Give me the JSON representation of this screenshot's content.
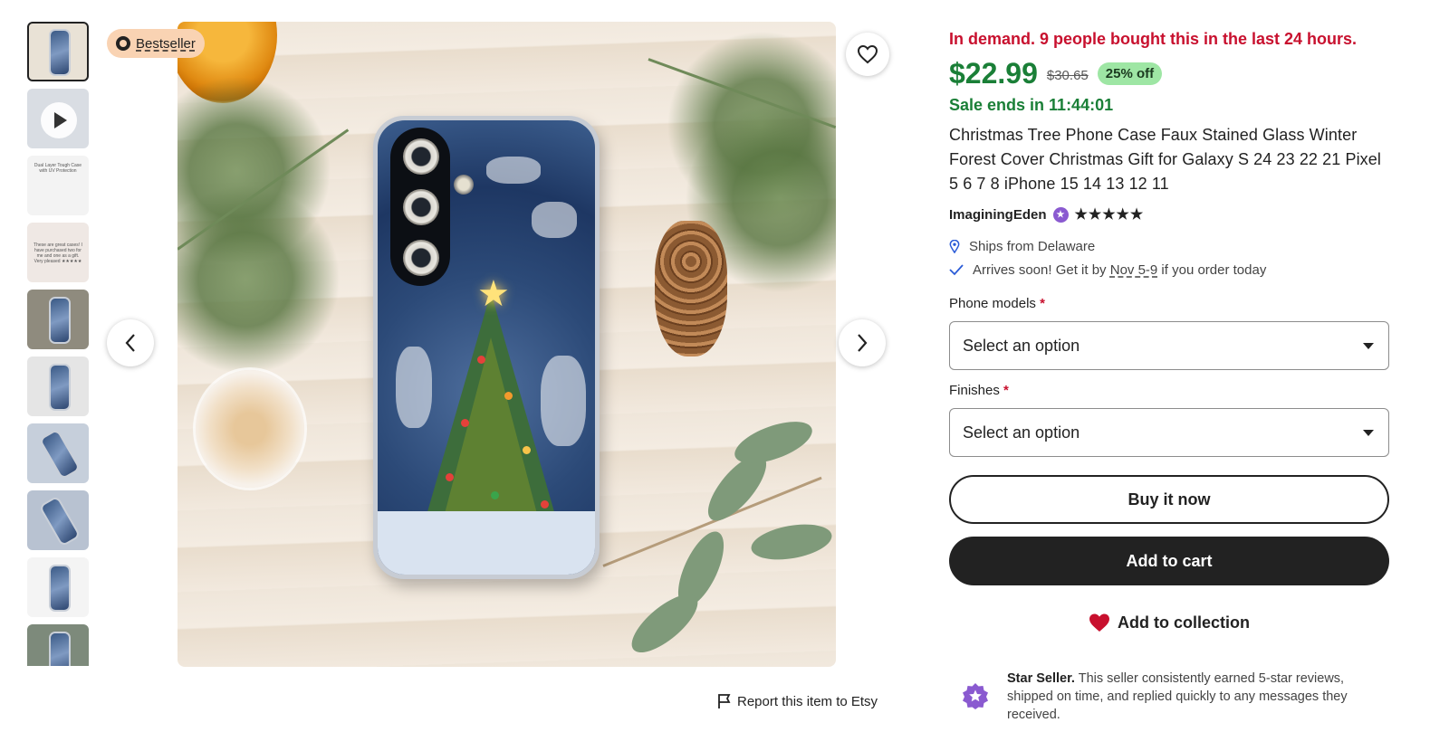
{
  "thumbnails": [
    {
      "kind": "image",
      "active": true
    },
    {
      "kind": "video"
    },
    {
      "kind": "image",
      "caption": "Dual Layer Tough Case with UV Protection"
    },
    {
      "kind": "image",
      "caption": "These are great cases! I have purchased two for me and one as a gift. Very pleased ★★★★★"
    },
    {
      "kind": "image"
    },
    {
      "kind": "image"
    },
    {
      "kind": "image"
    },
    {
      "kind": "image"
    },
    {
      "kind": "image"
    },
    {
      "kind": "image"
    }
  ],
  "image": {
    "badge_label": "Bestseller"
  },
  "report": {
    "label": "Report this item to Etsy"
  },
  "listing": {
    "demand_text": "In demand. 9 people bought this in the last 24 hours.",
    "price": "$22.99",
    "original_price": "$30.65",
    "discount": "25% off",
    "sale_ends": "Sale ends in 11:44:01",
    "title": "Christmas Tree Phone Case Faux Stained Glass Winter Forest Cover Christmas Gift for Galaxy S 24 23 22 21 Pixel 5 6 7 8 iPhone 15 14 13 12 11",
    "shop_name": "ImaginingEden",
    "rating_stars": "★★★★★",
    "rating_value": 5,
    "ships_from": "Ships from Delaware",
    "arrives_prefix": "Arrives soon! Get it by ",
    "arrives_dates": "Nov 5-9",
    "arrives_suffix": " if you order today"
  },
  "options": [
    {
      "label": "Phone models",
      "placeholder": "Select an option"
    },
    {
      "label": "Finishes",
      "placeholder": "Select an option"
    }
  ],
  "actions": {
    "buy_now": "Buy it now",
    "add_to_cart": "Add to cart",
    "add_to_collection": "Add to collection"
  },
  "star_seller": {
    "title": "Star Seller.",
    "text": " This seller consistently earned 5-star reviews, shipped on time, and replied quickly to any messages they received."
  },
  "colors": {
    "demand_red": "#c8102e",
    "price_green": "#1a7f37",
    "badge_peach": "#f9d3b3",
    "discount_green": "#9ee6a4",
    "star_seller_purple": "#8a5ad0"
  }
}
